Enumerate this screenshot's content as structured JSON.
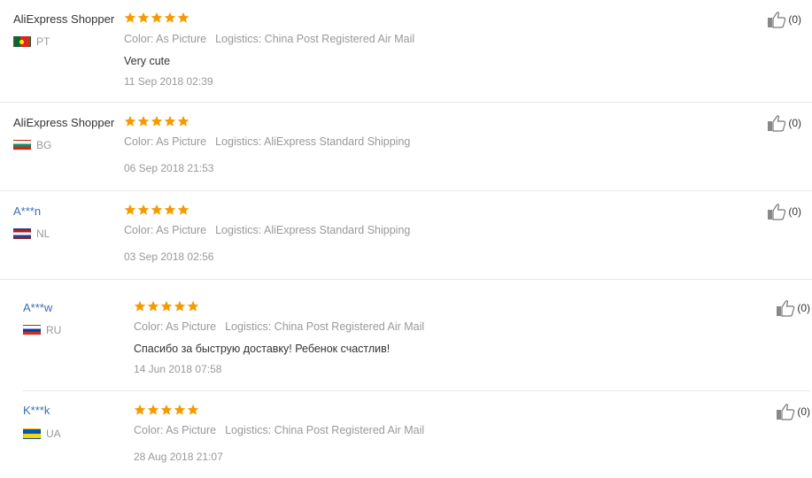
{
  "colors": {
    "star": "#f59b00",
    "link_user": "#3a6fb0",
    "meta_gray": "#999999"
  },
  "icons": {
    "rating": "star-icon",
    "helpful": "thumbs-up-icon"
  },
  "reviews": [
    {
      "user": "AliExpress Shopper",
      "country": "PT",
      "rating": 5,
      "color": "Color: As Picture",
      "logistics": "Logistics: China Post Registered Air Mail",
      "text": "Very cute",
      "date": "11 Sep 2018 02:39",
      "helpful": "(0)"
    },
    {
      "user": "AliExpress Shopper",
      "country": "BG",
      "rating": 5,
      "color": "Color: As Picture",
      "logistics": "Logistics: AliExpress Standard Shipping",
      "text": "",
      "date": "06 Sep 2018 21:53",
      "helpful": "(0)"
    },
    {
      "user": "A***n",
      "country": "NL",
      "rating": 5,
      "color": "Color: As Picture",
      "logistics": "Logistics: AliExpress Standard Shipping",
      "text": "",
      "date": "03 Sep 2018 02:56",
      "helpful": "(0)"
    },
    {
      "user": "A***w",
      "country": "RU",
      "rating": 5,
      "color": "Color: As Picture",
      "logistics": "Logistics: China Post Registered Air Mail",
      "text": "Спасибо за быструю доставку! Ребенок счастлив!",
      "date": "14 Jun 2018 07:58",
      "helpful": "(0)"
    },
    {
      "user": "K***k",
      "country": "UA",
      "rating": 5,
      "color": "Color: As Picture",
      "logistics": "Logistics: China Post Registered Air Mail",
      "text": "",
      "date": "28 Aug 2018 21:07",
      "helpful": "(0)"
    }
  ]
}
